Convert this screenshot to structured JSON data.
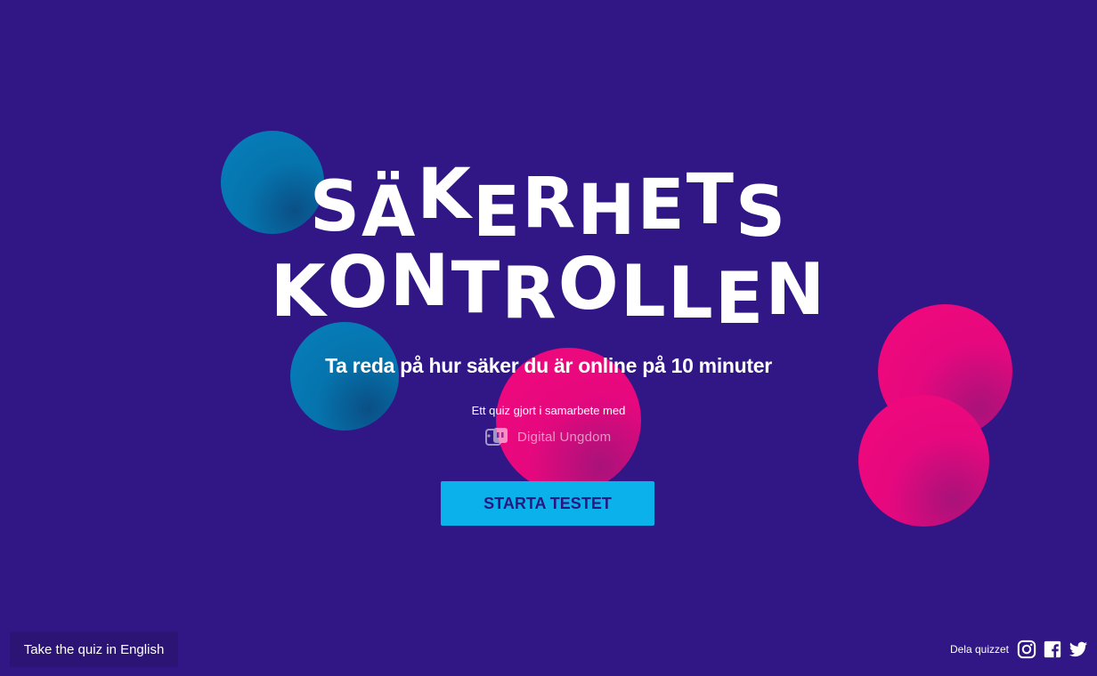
{
  "title": {
    "line1": "SÄKERHETS",
    "line2": "KONTROLLEN"
  },
  "subtitle": "Ta reda på hur säker du är online på 10 minuter",
  "collaboration": {
    "text": "Ett quiz gjort i samarbete med",
    "partner_name": "Digital Ungdom",
    "partner_icon": "digital-ungdom-logo"
  },
  "start_button": "STARTA TESTET",
  "language_button": "Take the quiz in English",
  "share": {
    "label": "Dela quizzet",
    "icons": [
      "instagram-icon",
      "facebook-icon",
      "twitter-icon"
    ]
  },
  "colors": {
    "background": "#311685",
    "button": "#0ab1ea",
    "button_text": "#2a1681",
    "blue_bubble": "#0674ad",
    "pink_bubble": "#e6087e"
  }
}
